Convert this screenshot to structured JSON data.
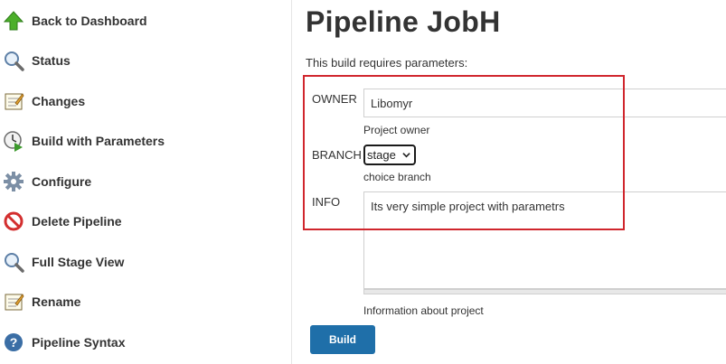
{
  "sidebar": {
    "items": [
      {
        "label": "Back to Dashboard",
        "icon": "up-arrow-icon"
      },
      {
        "label": "Status",
        "icon": "magnifier-icon"
      },
      {
        "label": "Changes",
        "icon": "notepad-icon"
      },
      {
        "label": "Build with Parameters",
        "icon": "clock-play-icon"
      },
      {
        "label": "Configure",
        "icon": "gear-icon"
      },
      {
        "label": "Delete Pipeline",
        "icon": "no-entry-icon"
      },
      {
        "label": "Full Stage View",
        "icon": "magnifier-icon"
      },
      {
        "label": "Rename",
        "icon": "notepad-icon"
      },
      {
        "label": "Pipeline Syntax",
        "icon": "help-icon"
      }
    ]
  },
  "main": {
    "title": "Pipeline JobH",
    "subtitle": "This build requires parameters:",
    "owner": {
      "label": "OWNER",
      "value": "Libomyr",
      "description": "Project owner"
    },
    "branch": {
      "label": "BRANCH",
      "selected": "stage",
      "description": "choice branch"
    },
    "info": {
      "label": "INFO",
      "value": "Its very simple project with parametrs",
      "description": "Information about project"
    },
    "build_label": "Build"
  },
  "colors": {
    "build_button": "#1f6fa9",
    "highlight_border": "#d0262d",
    "text": "#333333"
  }
}
